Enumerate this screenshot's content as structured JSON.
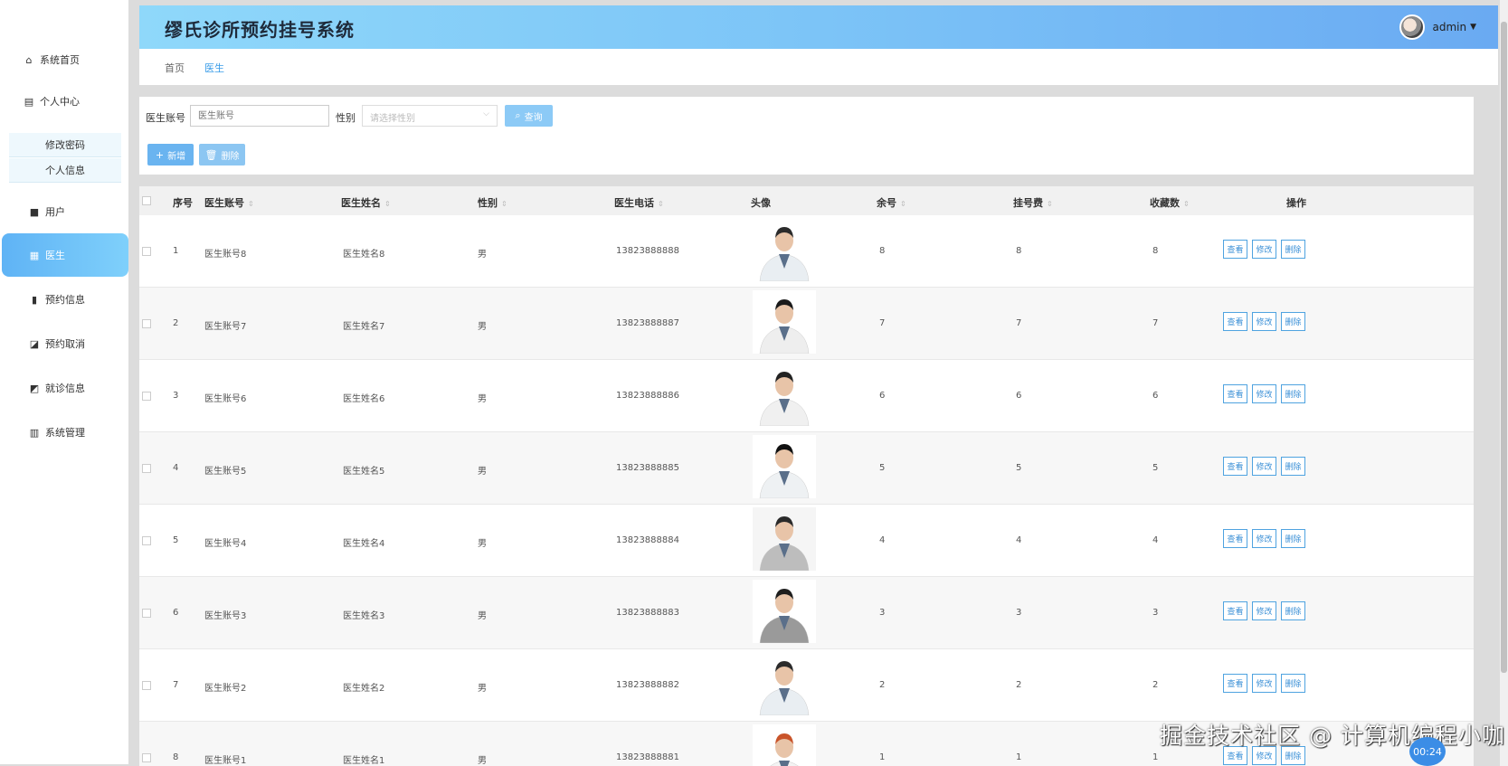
{
  "app": {
    "title": "缪氏诊所预约挂号系统",
    "user": "admin"
  },
  "sidebar": {
    "items": [
      {
        "label": "系统首页",
        "icon": "home-icon"
      },
      {
        "label": "个人中心",
        "icon": "profile-icon"
      },
      {
        "label": "用户",
        "icon": "briefcase-icon"
      },
      {
        "label": "医生",
        "icon": "grid-icon"
      },
      {
        "label": "预约信息",
        "icon": "clipboard-icon"
      },
      {
        "label": "预约取消",
        "icon": "chart-check-icon"
      },
      {
        "label": "就诊信息",
        "icon": "folder-icon"
      },
      {
        "label": "系统管理",
        "icon": "bar-chart-icon"
      }
    ],
    "sub_items": [
      {
        "label": "修改密码"
      },
      {
        "label": "个人信息"
      }
    ],
    "active": "医生"
  },
  "breadcrumb": {
    "home": "首页",
    "current": "医生"
  },
  "search": {
    "account_label": "医生账号",
    "account_placeholder": "医生账号",
    "gender_label": "性别",
    "gender_placeholder": "请选择性别",
    "search_button": "查询",
    "add_button": "新增",
    "delete_button": "删除"
  },
  "table": {
    "headers": {
      "index": "序号",
      "account": "医生账号",
      "name": "医生姓名",
      "gender": "性别",
      "phone": "医生电话",
      "avatar": "头像",
      "remaining": "余号",
      "fee": "挂号费",
      "favorites": "收藏数",
      "actions": "操作"
    },
    "action_labels": {
      "view": "查看",
      "edit": "修改",
      "delete": "删除"
    },
    "rows": [
      {
        "index": "1",
        "account": "医生账号8",
        "name": "医生姓名8",
        "gender": "男",
        "phone": "13823888888",
        "remaining": "8",
        "fee": "8",
        "favorites": "8"
      },
      {
        "index": "2",
        "account": "医生账号7",
        "name": "医生姓名7",
        "gender": "男",
        "phone": "13823888887",
        "remaining": "7",
        "fee": "7",
        "favorites": "7"
      },
      {
        "index": "3",
        "account": "医生账号6",
        "name": "医生姓名6",
        "gender": "男",
        "phone": "13823888886",
        "remaining": "6",
        "fee": "6",
        "favorites": "6"
      },
      {
        "index": "4",
        "account": "医生账号5",
        "name": "医生姓名5",
        "gender": "男",
        "phone": "13823888885",
        "remaining": "5",
        "fee": "5",
        "favorites": "5"
      },
      {
        "index": "5",
        "account": "医生账号4",
        "name": "医生姓名4",
        "gender": "男",
        "phone": "13823888884",
        "remaining": "4",
        "fee": "4",
        "favorites": "4"
      },
      {
        "index": "6",
        "account": "医生账号3",
        "name": "医生姓名3",
        "gender": "男",
        "phone": "13823888883",
        "remaining": "3",
        "fee": "3",
        "favorites": "3"
      },
      {
        "index": "7",
        "account": "医生账号2",
        "name": "医生姓名2",
        "gender": "男",
        "phone": "13823888882",
        "remaining": "2",
        "fee": "2",
        "favorites": "2"
      },
      {
        "index": "8",
        "account": "医生账号1",
        "name": "医生姓名1",
        "gender": "男",
        "phone": "13823888881",
        "remaining": "1",
        "fee": "1",
        "favorites": "1"
      }
    ]
  },
  "watermark": "掘金技术社区 @ 计算机编程小咖",
  "timer": "00:24",
  "colors": {
    "accent": "#3a9ce8",
    "header_start": "#8fd8fa",
    "header_end": "#6aaaf2"
  }
}
